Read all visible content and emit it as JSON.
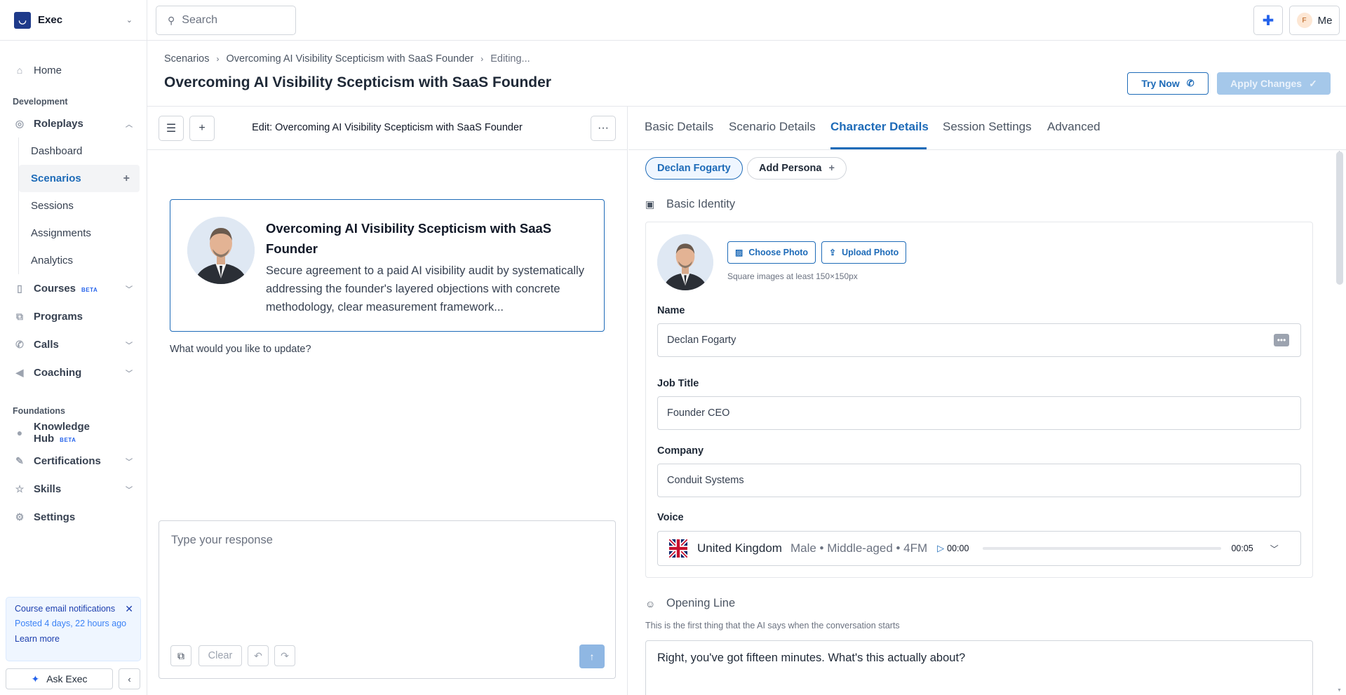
{
  "brand": {
    "name": "Exec"
  },
  "sidebar": {
    "home": "Home",
    "development_header": "Development",
    "roleplays": "Roleplays",
    "roleplay_items": [
      {
        "label": "Dashboard"
      },
      {
        "label": "Scenarios"
      },
      {
        "label": "Sessions"
      },
      {
        "label": "Assignments"
      },
      {
        "label": "Analytics"
      }
    ],
    "courses": "Courses",
    "courses_badge": "BETA",
    "programs": "Programs",
    "calls": "Calls",
    "coaching": "Coaching",
    "foundations_header": "Foundations",
    "knowledge_hub": "Knowledge Hub",
    "knowledge_badge": "BETA",
    "certifications": "Certifications",
    "skills": "Skills",
    "settings": "Settings",
    "notice": {
      "title": "Course email notifications",
      "posted": "Posted 4 days, 22 hours ago",
      "link": "Learn more"
    },
    "ask_label": "Ask Exec"
  },
  "topbar": {
    "search_placeholder": "Search",
    "avatar_initial": "F",
    "me_label": "Me"
  },
  "header": {
    "breadcrumbs": [
      "Scenarios",
      "Overcoming AI Visibility Scepticism with SaaS Founder",
      "Editing..."
    ],
    "title": "Overcoming AI Visibility Scepticism with SaaS Founder",
    "try_now": "Try Now",
    "apply_changes": "Apply Changes"
  },
  "chat": {
    "title": "Edit: Overcoming AI Visibility Scepticism with SaaS Founder",
    "card_title": "Overcoming AI Visibility Scepticism with SaaS Founder",
    "card_desc": "Secure agreement to a paid AI visibility audit by systematically addressing the founder's layered objections with concrete methodology, clear measurement framework...",
    "prompt": "What would you like to update?",
    "input_placeholder": "Type your response",
    "clear_label": "Clear"
  },
  "tabs": [
    {
      "label": "Basic Details"
    },
    {
      "label": "Scenario Details"
    },
    {
      "label": "Character Details"
    },
    {
      "label": "Session Settings"
    },
    {
      "label": "Advanced"
    }
  ],
  "character": {
    "persona": "Declan Fogarty",
    "add_persona": "Add Persona",
    "basic_identity": "Basic Identity",
    "choose_photo": "Choose Photo",
    "upload_photo": "Upload Photo",
    "photo_hint": "Square images at least 150×150px",
    "name_label": "Name",
    "name_value": "Declan Fogarty",
    "job_label": "Job Title",
    "job_value": "Founder CEO",
    "company_label": "Company",
    "company_value": "Conduit Systems",
    "voice_label": "Voice",
    "voice_country": "United Kingdom",
    "voice_meta": "Male • Middle-aged • 4FM",
    "voice_start": "00:00",
    "voice_end": "00:05",
    "opening_line_header": "Opening Line",
    "opening_line_hint": "This is the first thing that the AI says when the conversation starts",
    "opening_line_value": "Right, you've got fifteen minutes. What's this actually about?"
  },
  "colors": {
    "accent": "#1e6bb8",
    "brand": "#1e3a8a"
  }
}
